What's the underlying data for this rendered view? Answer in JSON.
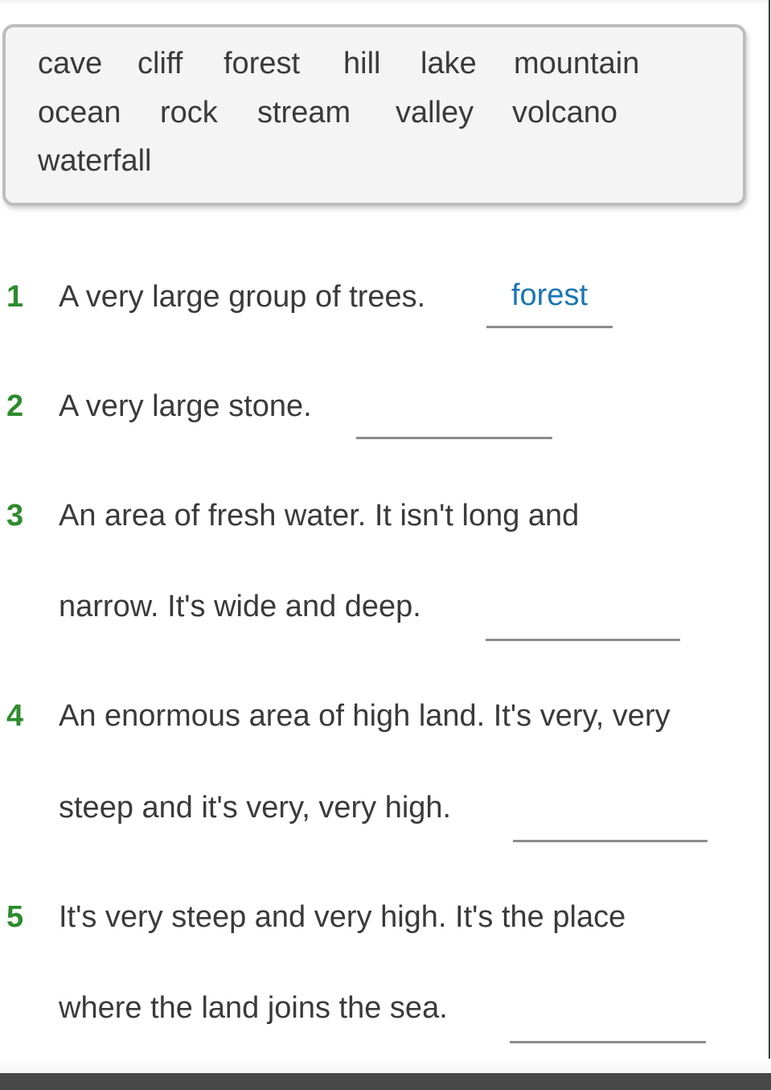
{
  "word_bank": {
    "rows": [
      [
        "cave",
        "cliff",
        "forest",
        "hill",
        "lake",
        "mountain"
      ],
      [
        "ocean",
        "rock",
        "stream",
        "valley",
        "volcano"
      ],
      [
        "waterfall"
      ]
    ]
  },
  "questions": [
    {
      "number": "1",
      "lines": [
        "A very large group of trees."
      ],
      "answer": "forest"
    },
    {
      "number": "2",
      "lines": [
        "A very large stone."
      ],
      "answer": ""
    },
    {
      "number": "3",
      "lines": [
        "An area of fresh water. It isn't long and",
        "narrow. It's wide and deep."
      ],
      "answer": ""
    },
    {
      "number": "4",
      "lines": [
        "An enormous area of high land. It's very, very",
        "steep and it's very, very high."
      ],
      "answer": ""
    },
    {
      "number": "5",
      "lines": [
        "It's very steep and very high. It's the place",
        "where the land joins the sea."
      ],
      "answer": ""
    }
  ],
  "colors": {
    "number_green": "#2e8b2e",
    "answer_blue": "#1a76b3",
    "text_gray": "#3a3a3a"
  }
}
